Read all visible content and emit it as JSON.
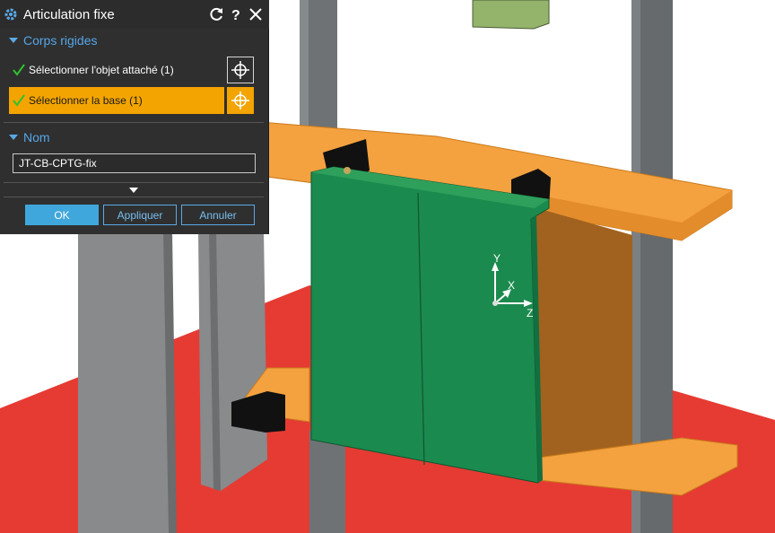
{
  "dialog": {
    "title": "Articulation fixe",
    "sections": {
      "rigid_bodies": {
        "label": "Corps rigides",
        "items": [
          {
            "label": "Sélectionner l'objet attaché (1)",
            "state": "selected"
          },
          {
            "label": "Sélectionner la base (1)",
            "state": "active"
          }
        ]
      },
      "name": {
        "label": "Nom",
        "value": "JT-CB-CPTG-fix"
      }
    },
    "buttons": {
      "ok": "OK",
      "apply": "Appliquer",
      "cancel": "Annuler"
    },
    "icons": [
      "gear-icon",
      "reset-icon",
      "help-icon",
      "close-icon",
      "check-icon",
      "crosshair-icon",
      "expand-icon"
    ]
  },
  "viewport": {
    "triad": {
      "y": "Y",
      "x": "X",
      "z": "Z"
    }
  },
  "colors": {
    "accent_blue": "#3fa7dc",
    "active_orange": "#f3a400",
    "dialog_bg": "#2f2f2f",
    "check_green": "#2fc22f",
    "part_orange": "#f4a140",
    "part_green": "#1b8a4e",
    "floor_red": "#e53b33"
  }
}
